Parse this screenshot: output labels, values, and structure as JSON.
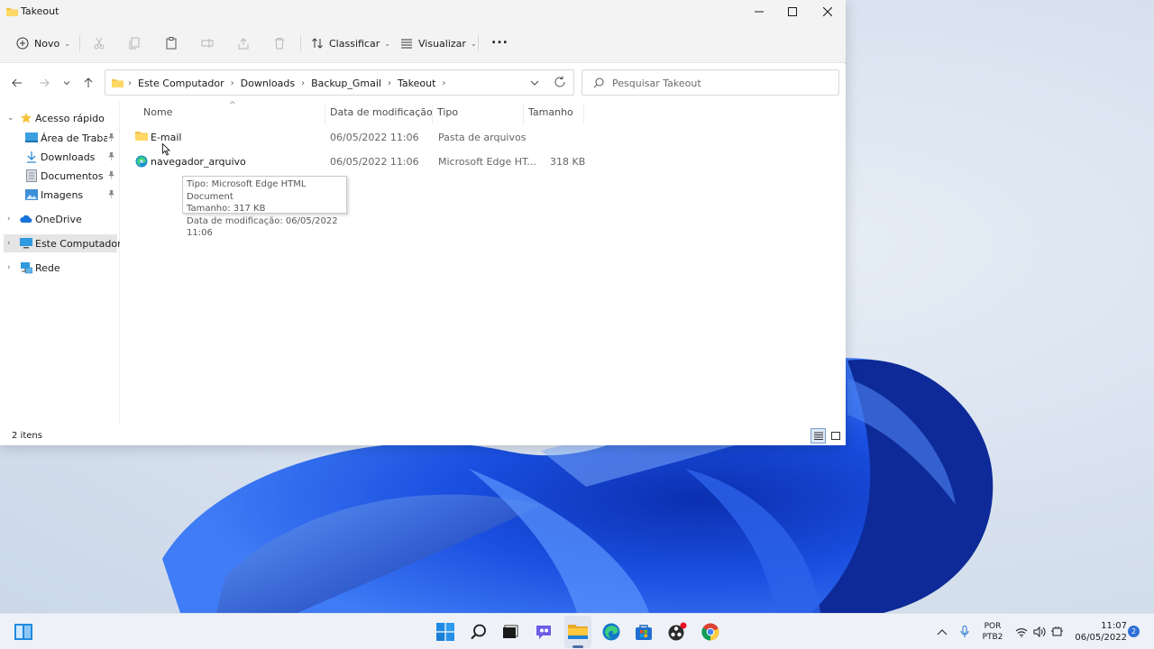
{
  "window": {
    "title": "Takeout",
    "controls": {
      "minimize": "minimize",
      "maximize": "maximize",
      "close": "close"
    }
  },
  "commandbar": {
    "new_label": "Novo",
    "sort_label": "Classificar",
    "view_label": "Visualizar",
    "more_label": "..."
  },
  "addressbar": {
    "breadcrumbs": [
      "Este Computador",
      "Downloads",
      "Backup_Gmail",
      "Takeout"
    ],
    "search_placeholder": "Pesquisar Takeout"
  },
  "sidebar": {
    "items": [
      {
        "label": "Acesso rápido"
      },
      {
        "label": "Área de Trabalho"
      },
      {
        "label": "Downloads"
      },
      {
        "label": "Documentos"
      },
      {
        "label": "Imagens"
      },
      {
        "label": "OneDrive"
      },
      {
        "label": "Este Computador"
      },
      {
        "label": "Rede"
      }
    ]
  },
  "columns": {
    "name": "Nome",
    "modified": "Data de modificação",
    "type": "Tipo",
    "size": "Tamanho"
  },
  "files": [
    {
      "name": "E-mail",
      "modified": "06/05/2022 11:06",
      "type": "Pasta de arquivos",
      "size": ""
    },
    {
      "name": "navegador_arquivo",
      "modified": "06/05/2022 11:06",
      "type": "Microsoft Edge HT...",
      "size": "318 KB"
    }
  ],
  "tooltip": {
    "line1": "Tipo: Microsoft Edge HTML Document",
    "line2": "Tamanho: 317 KB",
    "line3": "Data de modificação: 06/05/2022 11:06"
  },
  "status": {
    "count": "2 itens"
  },
  "taskbar": {
    "lang_top": "POR",
    "lang_bottom": "PTB2",
    "time": "11:07",
    "date": "06/05/2022",
    "notifications": "2"
  },
  "colors": {
    "accent": "#0067c0",
    "folder": "#f3c44d",
    "selected": "#e5e5e5"
  }
}
